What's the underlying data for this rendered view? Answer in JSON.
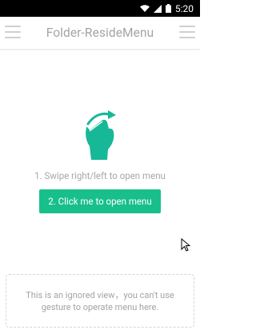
{
  "status_bar": {
    "time": "5:20"
  },
  "toolbar": {
    "title": "Folder-ResideMenu"
  },
  "main": {
    "hint": "1. Swipe right/left to open menu",
    "open_button_label": "2. Click me to open menu"
  },
  "ignored_view": {
    "line1": "This is an ignored view，you can't use",
    "line2": "gesture to operate menu here."
  },
  "colors": {
    "accent": "#18bf8a",
    "gesture": "#17b897"
  },
  "icons": [
    "wifi-icon",
    "signal-icon",
    "battery-icon",
    "menu-icon",
    "swipe-gesture-icon",
    "mouse-cursor-icon"
  ]
}
